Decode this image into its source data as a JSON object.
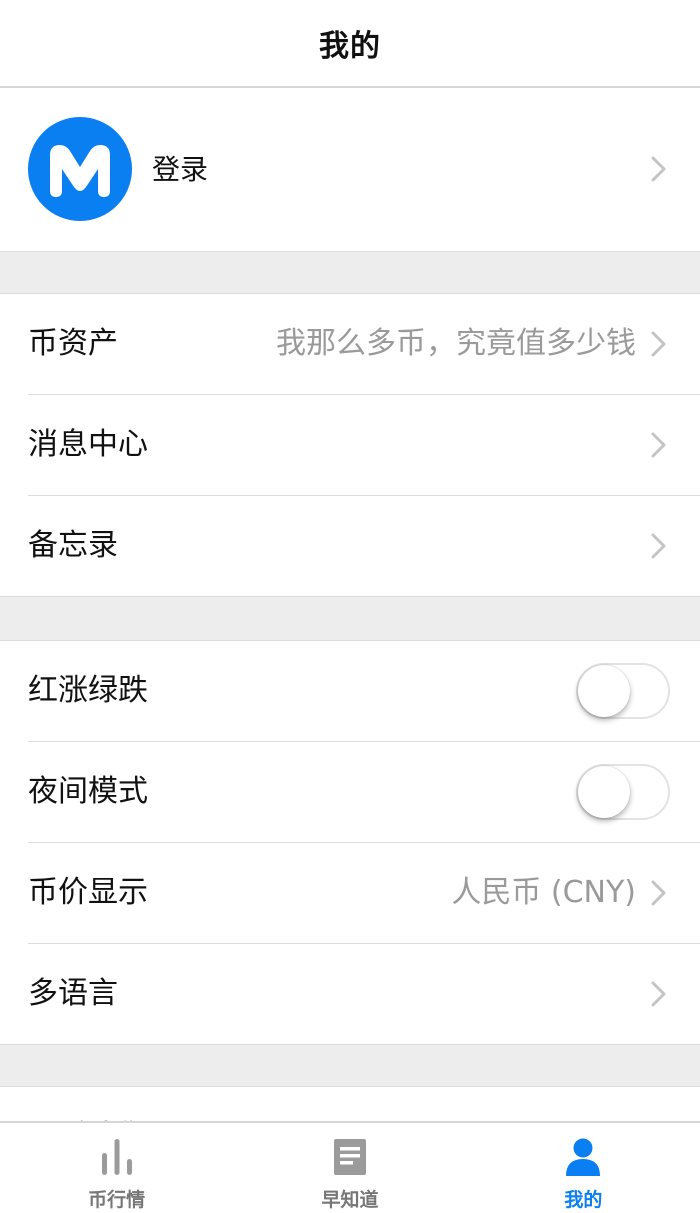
{
  "header": {
    "title": "我的"
  },
  "profile": {
    "login_label": "登录",
    "avatar_letter": "M"
  },
  "group1": {
    "items": [
      {
        "label": "币资产",
        "value": "我那么多币，究竟值多少钱"
      },
      {
        "label": "消息中心"
      },
      {
        "label": "备忘录"
      }
    ]
  },
  "group2": {
    "items": [
      {
        "label": "红涨绿跌",
        "toggle": false
      },
      {
        "label": "夜间模式",
        "toggle": false
      },
      {
        "label": "币价显示",
        "value": "人民币 (CNY)"
      },
      {
        "label": "多语言"
      }
    ]
  },
  "group3": {
    "items": [
      {
        "label": "联系我们"
      }
    ]
  },
  "tabbar": {
    "tabs": [
      {
        "label": "币行情",
        "icon": "bar-chart-icon"
      },
      {
        "label": "早知道",
        "icon": "document-icon"
      },
      {
        "label": "我的",
        "icon": "person-icon",
        "active": true
      }
    ]
  },
  "colors": {
    "accent": "#0a7ff2",
    "section_gap": "#ededed",
    "muted_text": "#9a9a9a"
  }
}
